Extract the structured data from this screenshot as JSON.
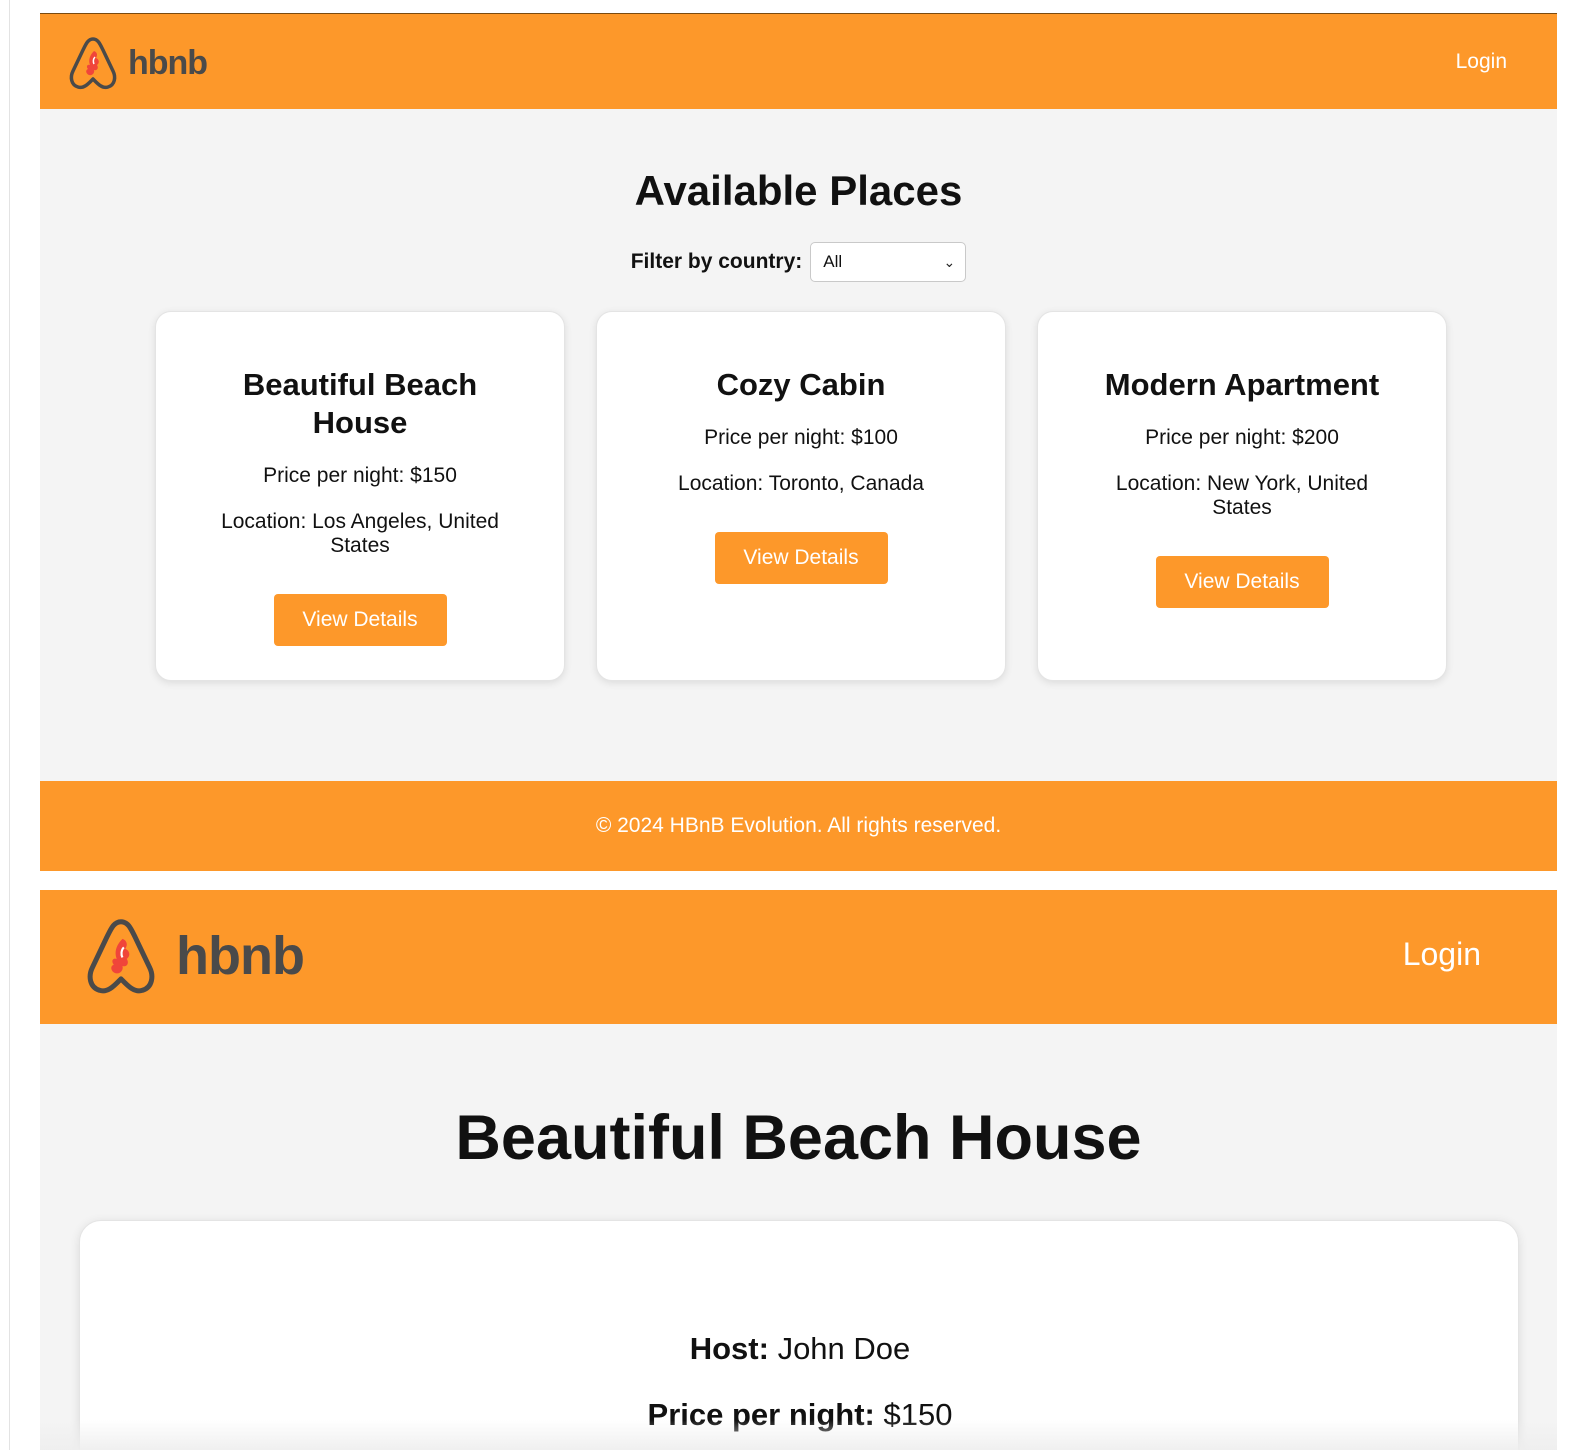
{
  "colors": {
    "accent": "#fd982a",
    "logo_red": "#f0453a",
    "logo_gray": "#4a4a4a",
    "page_bg": "#f4f4f4"
  },
  "list_page": {
    "header": {
      "logo_text": "hbnb",
      "logo_icon": "hbnb-flame-logo-icon",
      "login_label": "Login"
    },
    "title": "Available Places",
    "filter": {
      "label": "Filter by country:",
      "selected": "All"
    },
    "places": [
      {
        "name": "Beautiful Beach House",
        "price": "Price per night: $150",
        "location": "Location: Los Angeles, United States",
        "button": "View Details"
      },
      {
        "name": "Cozy Cabin",
        "price": "Price per night: $100",
        "location": "Location: Toronto, Canada",
        "button": "View Details"
      },
      {
        "name": "Modern Apartment",
        "price": "Price per night: $200",
        "location": "Location: New York, United States",
        "button": "View Details"
      }
    ],
    "footer": {
      "text": "© 2024 HBnB Evolution. All rights reserved."
    }
  },
  "detail_page": {
    "header": {
      "logo_text": "hbnb",
      "logo_icon": "hbnb-flame-logo-icon",
      "login_label": "Login"
    },
    "title": "Beautiful Beach House",
    "host_label": "Host:",
    "host_value": "John Doe",
    "price_label": "Price per night:",
    "price_value": "$150"
  }
}
